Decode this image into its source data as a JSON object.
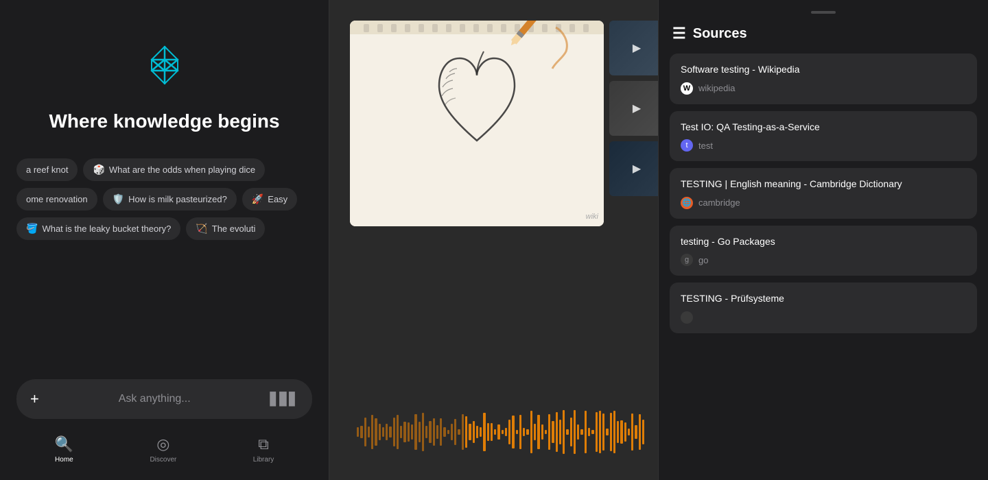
{
  "panel1": {
    "tagline": "Where knowledge begins",
    "search_placeholder": "Ask anything...",
    "chips_row1": [
      {
        "text": "a reef knot",
        "icon": ""
      },
      {
        "text": "What are the odds when playing dice",
        "icon": "🎲"
      }
    ],
    "chips_row2": [
      {
        "text": "ome renovation",
        "icon": ""
      },
      {
        "text": "How is milk pasteurized?",
        "icon": "🛡️"
      },
      {
        "text": "Easy",
        "icon": "🚀"
      }
    ],
    "chips_row3": [
      {
        "text": "What is the leaky bucket theory?",
        "icon": "🪣"
      },
      {
        "text": "The evoluti",
        "icon": "🏹"
      }
    ],
    "nav": [
      {
        "label": "Home",
        "active": true
      },
      {
        "label": "Discover",
        "active": false
      },
      {
        "label": "Library",
        "active": false
      }
    ]
  },
  "panel2": {
    "wiki_label": "wiki"
  },
  "panel3": {
    "header": "Sources",
    "sources": [
      {
        "title": "Software testing - Wikipedia",
        "site": "wikipedia",
        "favicon_type": "wikipedia",
        "favicon_letter": "W"
      },
      {
        "title": "Test IO: QA Testing-as-a-Service",
        "site": "test",
        "favicon_type": "test",
        "favicon_letter": "t"
      },
      {
        "title": "TESTING | English meaning - Cambridge Dictionary",
        "site": "cambridge",
        "favicon_type": "cambridge",
        "favicon_letter": "🌐"
      },
      {
        "title": "testing - Go Packages",
        "site": "go",
        "favicon_type": "go",
        "favicon_letter": "g"
      },
      {
        "title": "TESTING - Prüfsysteme",
        "site": "",
        "favicon_type": "go",
        "favicon_letter": ""
      }
    ]
  }
}
